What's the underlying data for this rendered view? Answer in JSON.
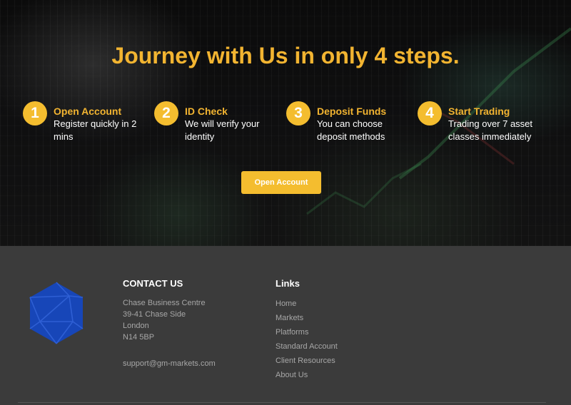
{
  "hero": {
    "headline": "Journey with Us in only 4 steps.",
    "steps": [
      {
        "number": "1",
        "title": "Open Account",
        "description": "Register quickly in 2 mins"
      },
      {
        "number": "2",
        "title": "ID Check",
        "description": "We will verify your identity"
      },
      {
        "number": "3",
        "title": "Deposit Funds",
        "description": "You can choose deposit methods"
      },
      {
        "number": "4",
        "title": "Start Trading",
        "description": "Trading over 7 asset classes immediately"
      }
    ],
    "cta_label": "Open Account"
  },
  "footer": {
    "logo_icon": "polyhedron-logo-icon",
    "contact": {
      "heading": "CONTACT US",
      "address_lines": [
        "Chase Business Centre",
        "39-41 Chase Side",
        "London",
        "N14 5BP"
      ],
      "email": "support@gm-markets.com"
    },
    "links": {
      "heading": "Links",
      "items": [
        "Home",
        "Markets",
        "Platforms",
        "Standard Account",
        "Client Resources",
        "About Us"
      ]
    }
  },
  "colors": {
    "accent": "#f4bd2f",
    "headline": "#f2b431",
    "footer_bg": "#3b3b3b",
    "footer_text": "#a7a7a7",
    "logo_blue": "#1746b8"
  }
}
